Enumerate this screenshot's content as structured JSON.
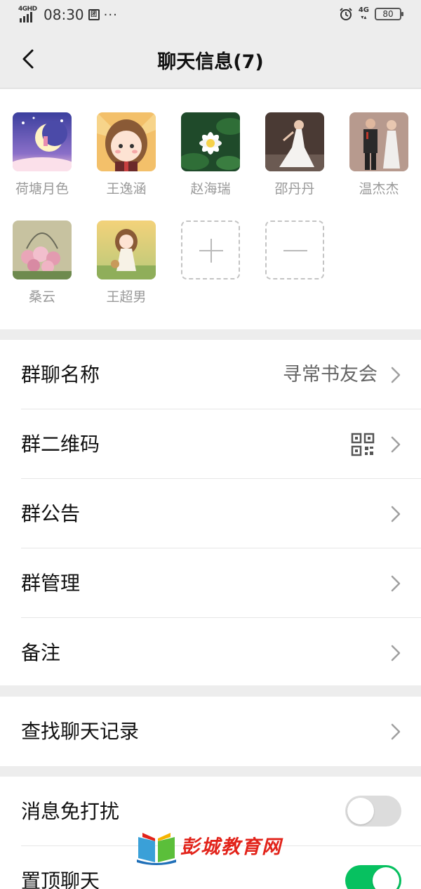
{
  "status_bar": {
    "network": "4GHD",
    "time": "08:30",
    "app_badge": "团",
    "more_dots": "···",
    "net_right": "4G",
    "battery": "80",
    "alarm_icon": "alarm-clock-icon"
  },
  "header": {
    "title": "聊天信息(7)",
    "back_icon": "chevron-left-icon"
  },
  "members": [
    {
      "name": "荷塘月色"
    },
    {
      "name": "王逸涵"
    },
    {
      "name": "赵海瑞"
    },
    {
      "name": "邵丹丹"
    },
    {
      "name": "温杰杰"
    },
    {
      "name": "桑云"
    },
    {
      "name": "王超男"
    }
  ],
  "member_actions": {
    "add_icon": "plus-icon",
    "remove_icon": "minus-icon"
  },
  "settings": {
    "group_name": {
      "label": "群聊名称",
      "value": "寻常书友会"
    },
    "group_qr": {
      "label": "群二维码",
      "icon": "qr-code-icon"
    },
    "announcement": {
      "label": "群公告"
    },
    "management": {
      "label": "群管理"
    },
    "remark": {
      "label": "备注"
    },
    "search_history": {
      "label": "查找聊天记录"
    },
    "mute": {
      "label": "消息免打扰",
      "enabled": false
    },
    "pin": {
      "label": "置顶聊天",
      "enabled": true
    }
  },
  "watermark": {
    "text": "彭城教育网"
  },
  "colors": {
    "accent_green": "#07c160",
    "background": "#ededed",
    "watermark_red": "#e2231a"
  }
}
